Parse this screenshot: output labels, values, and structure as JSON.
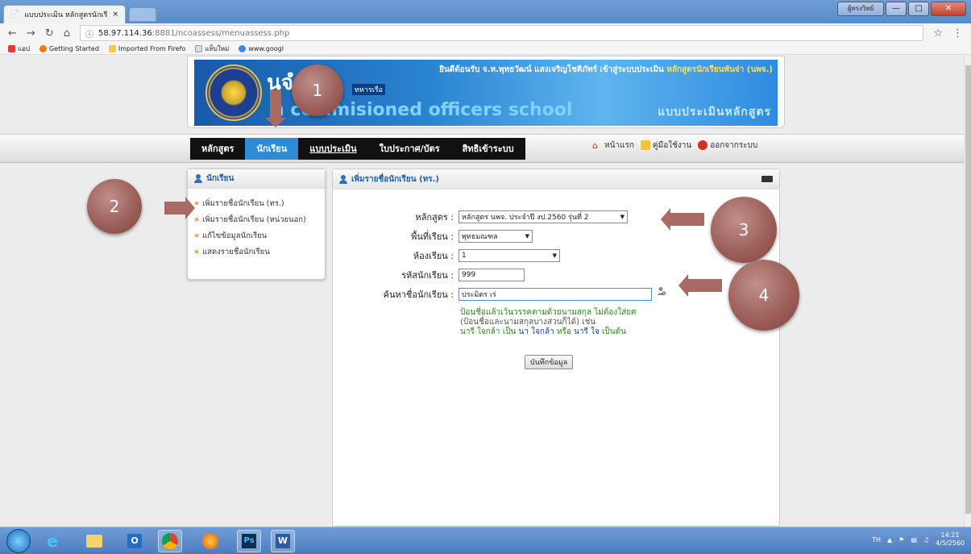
{
  "browser": {
    "tab_title": "แบบประเมิน หลักสูตรนักเรีย",
    "tab_close": "×",
    "url_host": "58.97.114.36",
    "url_path": ":8881/ncoassess/menuassess.php",
    "window_user_button": "ผู้ทรงวิทย์",
    "bookmarks": [
      {
        "label": "แอป",
        "color": "#e53935"
      },
      {
        "label": "Getting Started",
        "color": "#ff7a00"
      },
      {
        "label": "Imported From Firefo",
        "color": "#f7c948"
      },
      {
        "label": "แท็บใหม่",
        "color": "#cccccc"
      },
      {
        "label": "www.googl",
        "color": "#4285f4"
      }
    ]
  },
  "banner": {
    "word": "นจำ",
    "small": "ทหารเรือ",
    "school_text": "n commisioned officers school",
    "welcome_prefix": "ยินดีต้อนรับ จ.ท.พุทธวัฒน์ แสงเจริญโชติภัทร์ เข้าสู่ระบบประเมิน",
    "welcome_course": "หลักสูตรนักเรียนพันจ่า (นพจ.)",
    "assess_text": "แบบประเมินหลักสูตร"
  },
  "nav": {
    "items": [
      "หลักสูตร",
      "นักเรียน",
      "แบบประเมิน",
      "ใบประกาศ/บัตร",
      "สิทธิเข้าระบบ"
    ],
    "home": "หน้าแรก",
    "manual": "คู่มือใช้งาน",
    "logout": "ออกจากระบบ"
  },
  "sidebar": {
    "title": "นักเรียน",
    "items": [
      "เพิ่มรายชื่อนักเรียน (ทร.)",
      "เพิ่มรายชื่อนักเรียน (หน่วยนอก)",
      "แก้ไขข้อมูลนักเรียน",
      "แสดงรายชื่อนักเรียน"
    ]
  },
  "main": {
    "title": "เพิ่มรายชื่อนักเรียน (ทร.)",
    "fields": {
      "course_label": "หลักสูตร :",
      "course_value": "หลักสูตร นพจ. ประจำปี งป.2560 รุ่นที่ 2",
      "area_label": "พื้นที่เรียน :",
      "area_value": "พุทธมณฑล",
      "room_label": "ห้องเรียน :",
      "room_value": "1",
      "student_id_label": "รหัสนักเรียน :",
      "student_id_value": "999",
      "search_label": "ค้นหาชื่อนักเรียน :",
      "search_value": "ประมิตร เร่"
    },
    "hint_line1": "ป้อนชื่อแล้วเว้นวรรคตามด้วยนามสกุล ไม่ต้องใส่ยศ",
    "hint_line2": "(ป้อนชื่อและนามสกุลบางส่วนก็ได้) เช่น",
    "hint_line3a": "นารี ใจกล้า",
    "hint_line3b": "เป็น",
    "hint_line3c": "นา ใจกล้า",
    "hint_line3d": "หรือ",
    "hint_line3e": "นารี ใจ",
    "hint_line3f": "เป็นต้น",
    "save_button": "บันทึกข้อมูล"
  },
  "annotations": [
    "1",
    "2",
    "3",
    "4"
  ],
  "taskbar": {
    "lang": "TH",
    "time": "14:21",
    "date": "4/5/2560"
  }
}
